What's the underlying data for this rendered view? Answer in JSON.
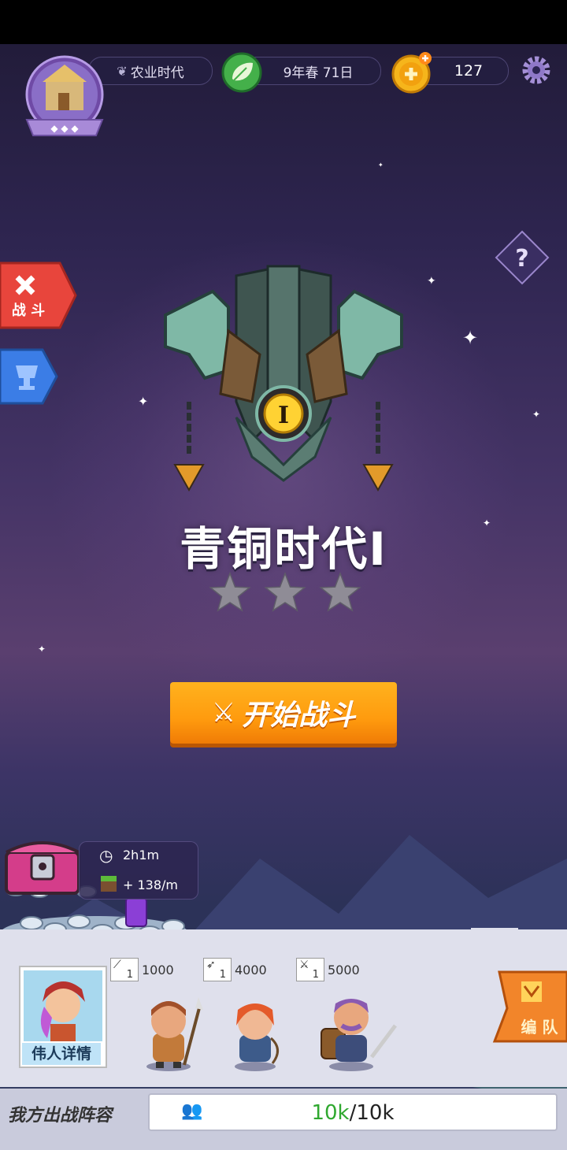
{
  "hud": {
    "era_label": "农业时代",
    "date_label": "9年春 71日",
    "coin_count": "127"
  },
  "side_tabs": {
    "battle_label": "战 斗"
  },
  "stage": {
    "title": "青铜时代I",
    "emblem_numeral": "I",
    "stars_earned": 0,
    "stars_total": 3
  },
  "start_button": {
    "label": "开始战斗"
  },
  "chest": {
    "timer": "2h1m",
    "rate": "+ 138/m"
  },
  "army": {
    "units": [
      {
        "level": "1",
        "cost": "1000",
        "weapon_icon": "spear-icon"
      },
      {
        "level": "1",
        "cost": "4000",
        "weapon_icon": "bow-icon"
      },
      {
        "level": "1",
        "cost": "5000",
        "weapon_icon": "sword-icon"
      }
    ],
    "great_person_label": "伟人详情",
    "formation_label": "编 队"
  },
  "bottom": {
    "lineup_label": "我方出战阵容",
    "power_current": "10k",
    "power_max": "/10k"
  },
  "colors": {
    "accent_orange": "#ff9b0e",
    "power_green": "#2fa82f"
  }
}
